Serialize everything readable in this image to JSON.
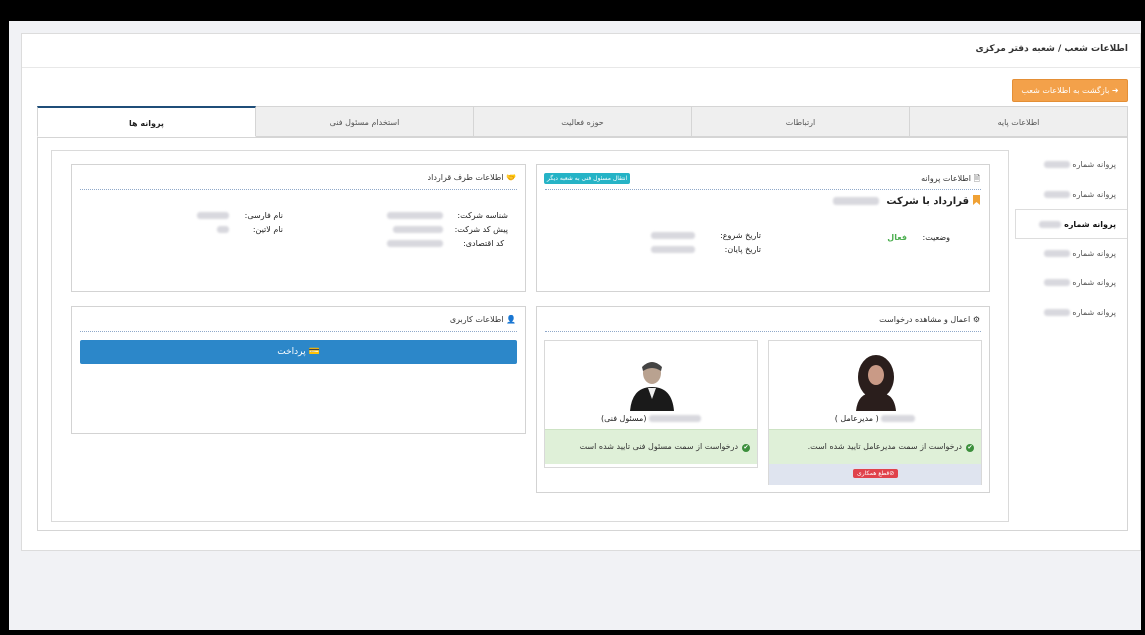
{
  "breadcrumb": "اطلاعات شعب / شعبه دفتر مرکزی",
  "back_button": "بازگشت به اطلاعات شعب",
  "tabs": [
    "اطلاعات پایه",
    "ارتباطات",
    "حوزه فعالیت",
    "استخدام مسئول فنی",
    "پروانه ها"
  ],
  "active_tab": "پروانه ها",
  "side_nav": {
    "items": [
      "پروانه شماره",
      "پروانه شماره",
      "پروانه شماره",
      "پروانه شماره",
      "پروانه شماره",
      "پروانه شماره"
    ],
    "active_index": 2
  },
  "license_panel": {
    "title": "اطلاعات پروانه",
    "transfer_badge": "انتقال مسئول فنی به شعبه دیگر",
    "contract_label": "قرارداد با شرکت",
    "status_label": "وضعیت:",
    "status_value": "فعال",
    "start_label": "تاریخ شروع:",
    "end_label": "تاریخ پایان:"
  },
  "party_panel": {
    "title": "اطلاعات طرف قرارداد",
    "company_id_label": "شناسه شرکت:",
    "prefix_label": "پیش کد شرکت:",
    "economic_label": "کد اقتصادی:",
    "persian_name_label": "نام فارسی:",
    "latin_name_label": "نام لاتین:"
  },
  "user_panel": {
    "title": "اطلاعات کاربری",
    "pay_button": "پرداخت"
  },
  "requests_panel": {
    "title": "اعمال و مشاهده درخواست",
    "ceo": {
      "role": "( مدیرعامل )",
      "status": "درخواست از سمت مدیرعامل تایید شده است.",
      "end_badge": "قطع همکاری"
    },
    "tech": {
      "role": "(مسئول فنی)",
      "status": "درخواست از سمت مسئول فنی تایید شده است"
    }
  },
  "colors": {
    "tab_active": "#1f4e79",
    "back_button": "#f3a14a",
    "pay_button": "#2c87c9",
    "status_active": "#4caf50",
    "success_bg": "#dff0d8",
    "end_badge": "#e0424b",
    "transfer_badge": "#25b3c6"
  },
  "icons": {
    "back": "arrow-right-icon",
    "license": "document-icon",
    "party": "handshake-icon",
    "user": "user-icon",
    "requests": "gear-icon",
    "pay": "credit-card-icon",
    "check": "check-circle-icon",
    "end": "cancel-icon",
    "contract": "bookmark-icon"
  }
}
